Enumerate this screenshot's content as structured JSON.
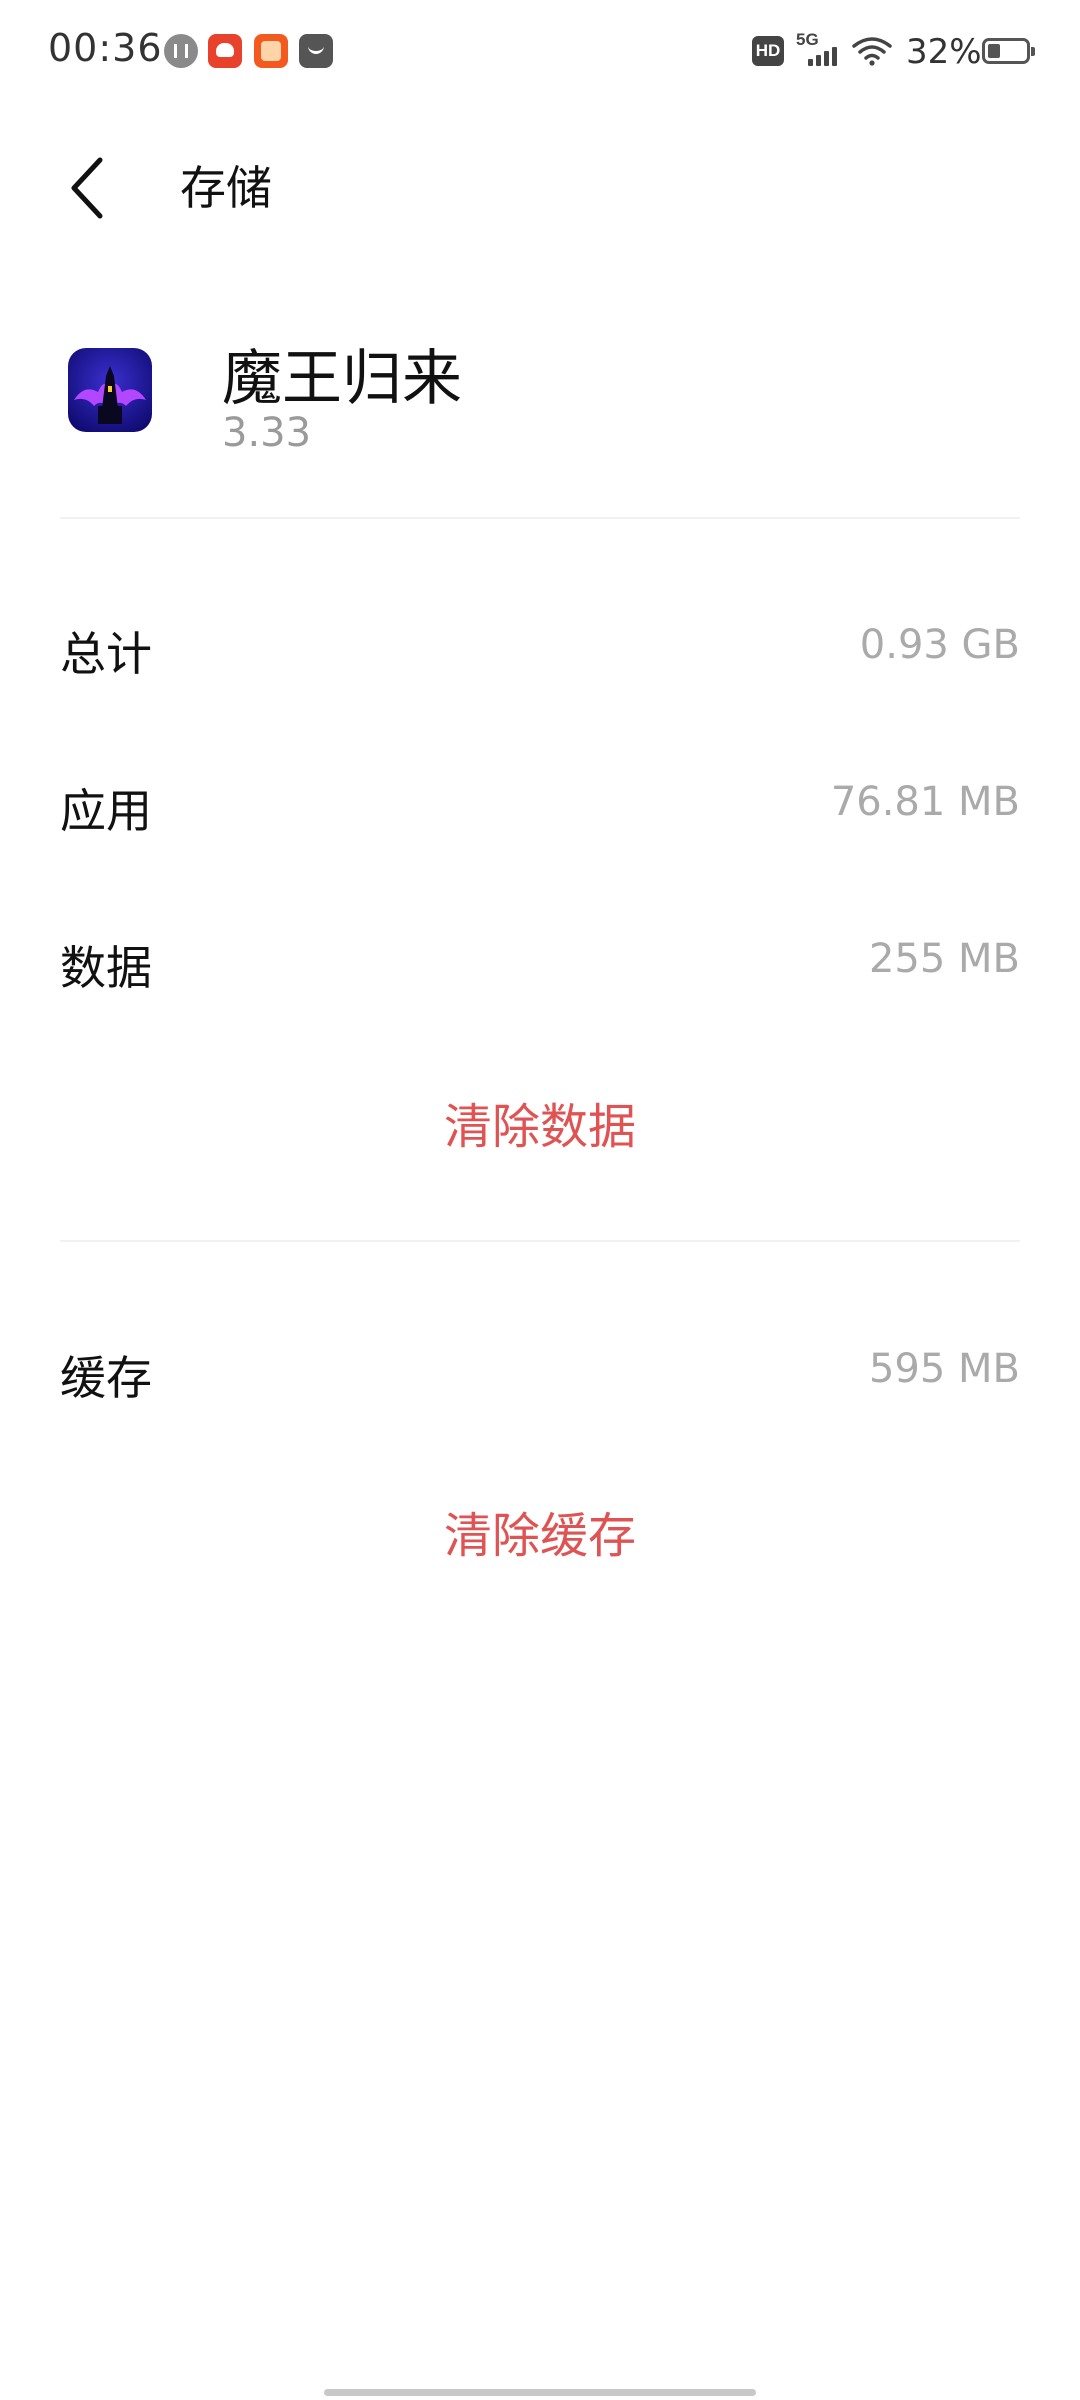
{
  "status_bar": {
    "time": "00:36",
    "network_type": "5G",
    "hd_label": "HD",
    "battery_percent": "32%",
    "battery_level": 0.32,
    "notification_icons": [
      "voice-assistant-icon",
      "app-notification-icon",
      "taobao-icon",
      "message-icon"
    ]
  },
  "header": {
    "title": "存储",
    "back_icon": "chevron-left-icon"
  },
  "app": {
    "name": "魔王归来",
    "version": "3.33",
    "icon": "game-app-icon"
  },
  "storage": {
    "total_label": "总计",
    "total_value": "0.93 GB",
    "app_label": "应用",
    "app_value": "76.81 MB",
    "data_label": "数据",
    "data_value": "255 MB",
    "clear_data_label": "清除数据",
    "cache_label": "缓存",
    "cache_value": "595 MB",
    "clear_cache_label": "清除缓存"
  },
  "colors": {
    "accent_red": "#e05353",
    "secondary_text": "#aaaaaa",
    "primary_text": "#111111"
  }
}
